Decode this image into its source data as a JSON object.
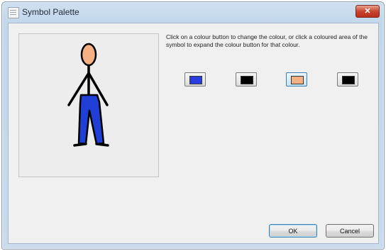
{
  "window": {
    "title": "Symbol Palette",
    "close_glyph": "✕"
  },
  "instructions": "Click on a colour button to change the colour, or click a coloured area of the symbol to expand the colour button for that colour.",
  "symbol": {
    "colors": {
      "head": "#f5b183",
      "trousers": "#1f3fd6",
      "outline": "#000000"
    }
  },
  "colour_buttons": [
    {
      "color": "#2a3ee0",
      "selected": false
    },
    {
      "color": "#000000",
      "selected": false
    },
    {
      "color": "#f5b183",
      "selected": true
    },
    {
      "color": "#000000",
      "selected": false
    }
  ],
  "buttons": {
    "ok": "OK",
    "cancel": "Cancel"
  }
}
